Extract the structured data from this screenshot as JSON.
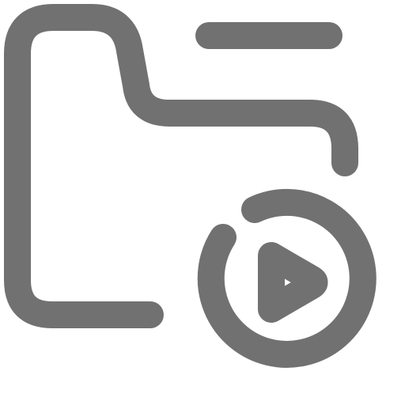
{
  "icon": {
    "name": "folder-play-icon",
    "color": "#717171"
  }
}
